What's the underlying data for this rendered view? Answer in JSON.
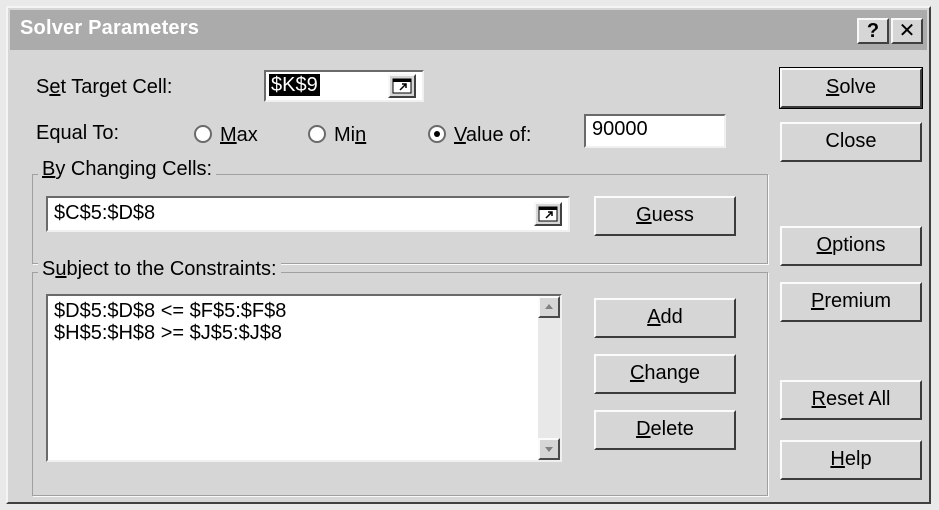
{
  "window": {
    "title": "Solver Parameters",
    "help_glyph": "?",
    "close_glyph": "✕"
  },
  "target": {
    "label_pre": "S",
    "label_ul": "e",
    "label_post": "t Target Cell:",
    "value": "$K$9"
  },
  "equal_to": {
    "label": "Equal To:",
    "max": {
      "ul": "M",
      "rest": "ax"
    },
    "min": {
      "pre": "Mi",
      "ul": "n"
    },
    "value_of": {
      "ul": "V",
      "rest": "alue of:"
    },
    "selected": "value_of",
    "value": "90000"
  },
  "changing": {
    "label_ul": "B",
    "label_rest": "y Changing Cells:",
    "value": "$C$5:$D$8",
    "guess": {
      "ul": "G",
      "rest": "uess"
    }
  },
  "constraints": {
    "label_pre": "S",
    "label_ul": "u",
    "label_rest": "bject to the Constraints:",
    "items": [
      "$D$5:$D$8 <= $F$5:$F$8",
      "$H$5:$H$8 >= $J$5:$J$8"
    ],
    "add": {
      "ul": "A",
      "rest": "dd"
    },
    "change": {
      "ul": "C",
      "rest": "hange"
    },
    "delete": {
      "ul": "D",
      "rest": "elete"
    }
  },
  "buttons": {
    "solve": {
      "ul": "S",
      "rest": "olve"
    },
    "close": "Close",
    "options": {
      "ul": "O",
      "rest": "ptions"
    },
    "premium": {
      "ul": "P",
      "rest": "remium"
    },
    "reset": {
      "ul": "R",
      "rest": "eset All"
    },
    "help": {
      "ul": "H",
      "rest": "elp"
    }
  }
}
